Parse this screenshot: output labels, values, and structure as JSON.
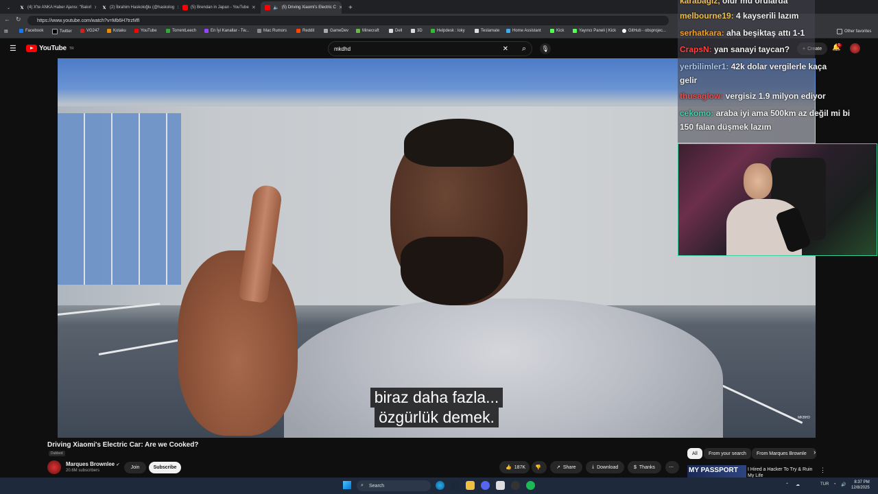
{
  "browser": {
    "tabs": [
      {
        "label": "(4) X'te ANKA Haber Ajansı: \"Bakırl",
        "icon": "x-icon",
        "active": false
      },
      {
        "label": "(2) İbrahim Haskoloğlu (@haskolog",
        "icon": "x-icon",
        "active": false
      },
      {
        "label": "(5) Brendan in Japan - YouTube",
        "icon": "youtube-icon",
        "active": false
      },
      {
        "label": "(5) Driving Xiaomi's Electric C",
        "icon": "youtube-icon",
        "active": true
      }
    ],
    "url": "https://www.youtube.com/watch?v=Mb6H7trzMfI",
    "bookmarks": [
      "Facebook",
      "Twitter",
      "VG247",
      "Kotaku",
      "YouTube",
      "TorrentLeech",
      "En İyi Kanallar - Tw...",
      "Mac Rumors",
      "Reddit",
      "GameDev",
      "Minecraft",
      "Dell",
      "3D",
      "Helpdesk : loky",
      "Teslamate",
      "Home Assistant",
      "Kick",
      "Yayıncı Paneli | Kick",
      "GitHub - obsprojec...",
      "Other favorites"
    ]
  },
  "youtube": {
    "logo_text": "YouTube",
    "country": "TR",
    "search_value": "mkdhd",
    "create_label": "Create",
    "notif_count": "5"
  },
  "video": {
    "subtitle_line1": "biraz daha fazla...",
    "subtitle_line2": "özgürlük demek.",
    "watermark": "MKBHD",
    "title": "Driving Xiaomi's Electric Car: Are we Cooked?",
    "dubbed": "Dubbed",
    "channel": "Marques Brownlee",
    "subscribers": "20.6M subscribers",
    "join": "Join",
    "subscribe": "Subscribe",
    "likes": "187K",
    "share": "Share",
    "download": "Download",
    "thanks": "Thanks"
  },
  "chips": [
    "All",
    "From your search",
    "From Marques Brownle"
  ],
  "recommend": {
    "title": "I Hired a Hacker To Try & Ruin My Life",
    "thumb_text": "MY PASSPORT"
  },
  "stream_chat": [
    {
      "user": "karabağız,",
      "text": "olur mu orularda",
      "color": "#f0c060"
    },
    {
      "user": "melbourne19:",
      "text": "4 kayserili lazım",
      "color": "#f0c040"
    },
    {
      "user": "serhatkara:",
      "text": "aha beşiktaş attı 1-1",
      "color": "#f0a030"
    },
    {
      "user": "CrapsN:",
      "text": "yan sanayi taycan?",
      "color": "#ff4040"
    },
    {
      "user": "yerbilimler1:",
      "text": "42k dolar vergilerle kaça gelir",
      "color": "#a8c8f0"
    },
    {
      "user": "thusaglow:",
      "text": "vergisiz 1.9 milyon ediyor",
      "color": "#e05050"
    },
    {
      "user": "cekomo:",
      "text": "araba iyi ama 500km az değil mi bi 150 falan düşmek lazım",
      "color": "#40d0b0"
    }
  ],
  "taskbar": {
    "search_placeholder": "Search",
    "lang": "TUR",
    "time": "8:37 PM",
    "date": "12/8/2025"
  }
}
